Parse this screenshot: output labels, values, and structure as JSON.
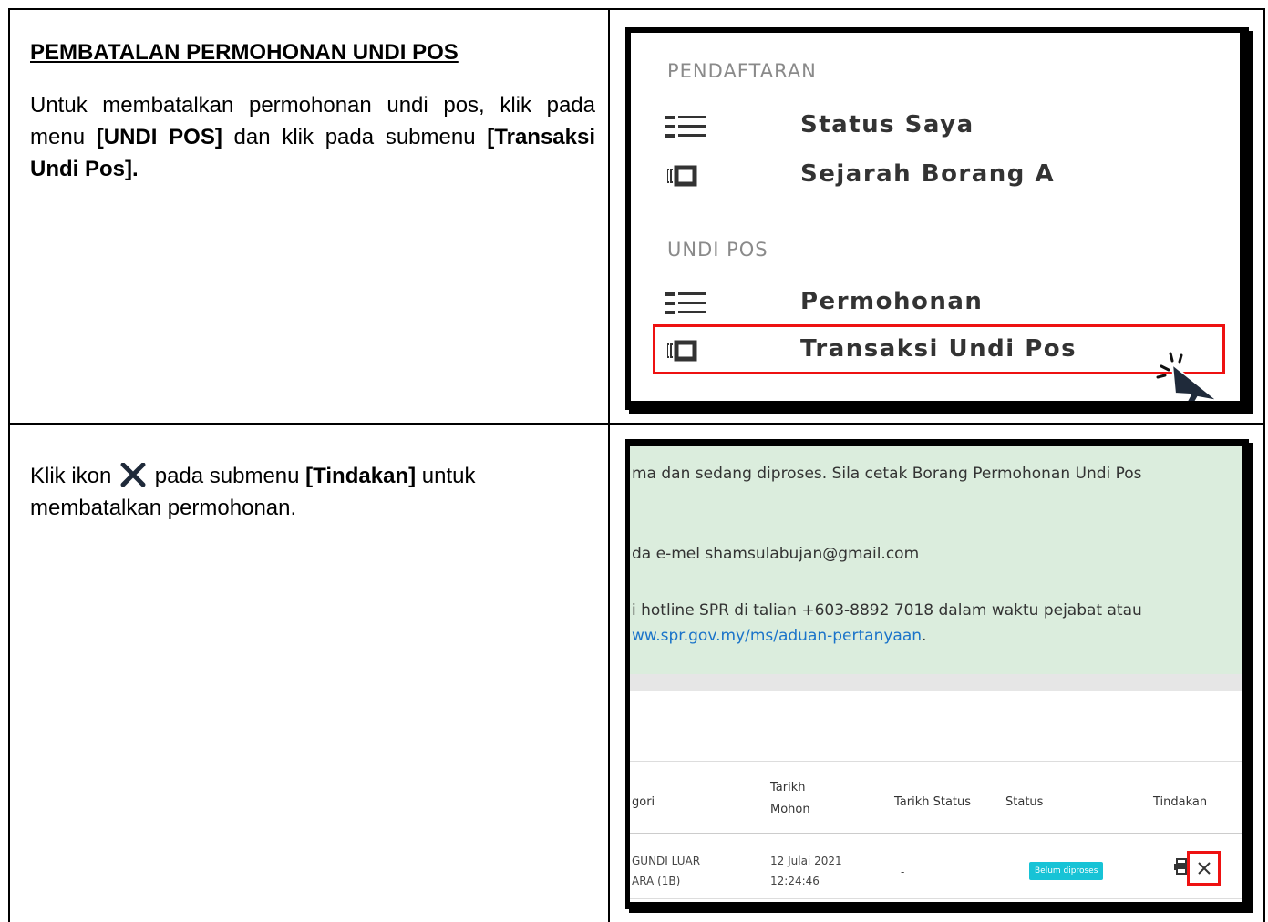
{
  "row1": {
    "heading": "PEMBATALAN PERMOHONAN UNDI POS",
    "text_a": "Untuk membatalkan permohonan undi pos, klik pada menu ",
    "bold_a": "[UNDI POS]",
    "text_b": " dan klik pada submenu ",
    "bold_b": "[Transaksi Undi Pos]."
  },
  "row2": {
    "text_a": "Klik ikon",
    "text_b": " pada submenu ",
    "bold_a": "[Tindakan]",
    "text_c": " untuk membatalkan permohonan.",
    "icon": "x-icon"
  },
  "menu": {
    "section_1": "PENDAFTARAN",
    "item_1": "Status Saya",
    "item_2": "Sejarah Borang A",
    "section_2": "UNDI POS",
    "item_3": "Permohonan",
    "item_4": "Transaksi Undi Pos",
    "highlight_color": "#e11111"
  },
  "notice": {
    "line_1": "ma dan sedang diproses. Sila cetak Borang Permohonan Undi Pos",
    "line_2": "da e-mel shamsulabujan@gmail.com",
    "line_3": "i hotline SPR di talian +603-8892 7018 dalam waktu pejabat atau",
    "link": "ww.spr.gov.my/ms/aduan-pertanyaan",
    "link_suffix": "."
  },
  "table": {
    "headers": [
      "gori",
      "Tarikh",
      "Mohon",
      "Tarikh Status",
      "Status",
      "Tindakan"
    ],
    "row": {
      "kategori_1": "GUNDI LUAR",
      "kategori_2": "ARA (1B)",
      "tarikh_1": "12 Julai 2021",
      "tarikh_2": "12:24:46",
      "tarikh_status": "-",
      "status": "Belum diproses"
    }
  }
}
